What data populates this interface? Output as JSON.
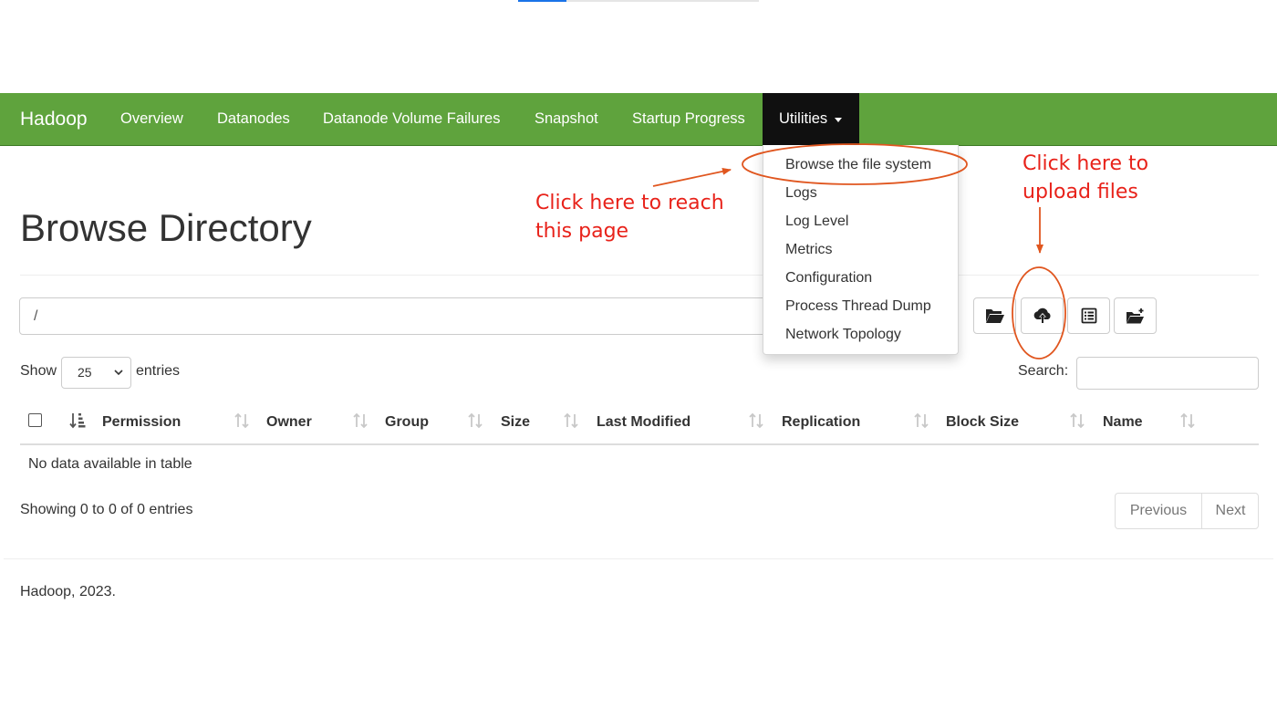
{
  "browser": {
    "progress_percent": 20
  },
  "navbar": {
    "brand": "Hadoop",
    "items": [
      {
        "id": "overview",
        "label": "Overview"
      },
      {
        "id": "datanodes",
        "label": "Datanodes"
      },
      {
        "id": "volume-failures",
        "label": "Datanode Volume Failures"
      },
      {
        "id": "snapshot",
        "label": "Snapshot"
      },
      {
        "id": "startup",
        "label": "Startup Progress"
      }
    ],
    "utilities_label": "Utilities",
    "color": "#5fa33d",
    "active_color": "#101010"
  },
  "dropdown": {
    "items": [
      "Browse the file system",
      "Logs",
      "Log Level",
      "Metrics",
      "Configuration",
      "Process Thread Dump",
      "Network Topology"
    ]
  },
  "page": {
    "title": "Browse Directory",
    "path_value": "/",
    "toolbar_icons": [
      "folder-open-icon",
      "cloud-upload-icon",
      "list-icon",
      "folder-plus-icon"
    ]
  },
  "table_controls": {
    "show_label": "Show",
    "page_size": "25",
    "entries_label": "entries",
    "search_label": "Search:",
    "search_value": ""
  },
  "table": {
    "columns": [
      "Permission",
      "Owner",
      "Group",
      "Size",
      "Last Modified",
      "Replication",
      "Block Size",
      "Name"
    ],
    "empty_text": "No data available in table",
    "info": "Showing 0 to 0 of 0 entries",
    "prev_label": "Previous",
    "next_label": "Next"
  },
  "footer": {
    "text": "Hadoop, 2023."
  },
  "annotations": {
    "reach_line1": "Click here to reach",
    "reach_line2": "this page",
    "upload_line1": "Click here to",
    "upload_line2": "upload files",
    "color": "#e8221a",
    "arrow_color": "#e0561f"
  }
}
